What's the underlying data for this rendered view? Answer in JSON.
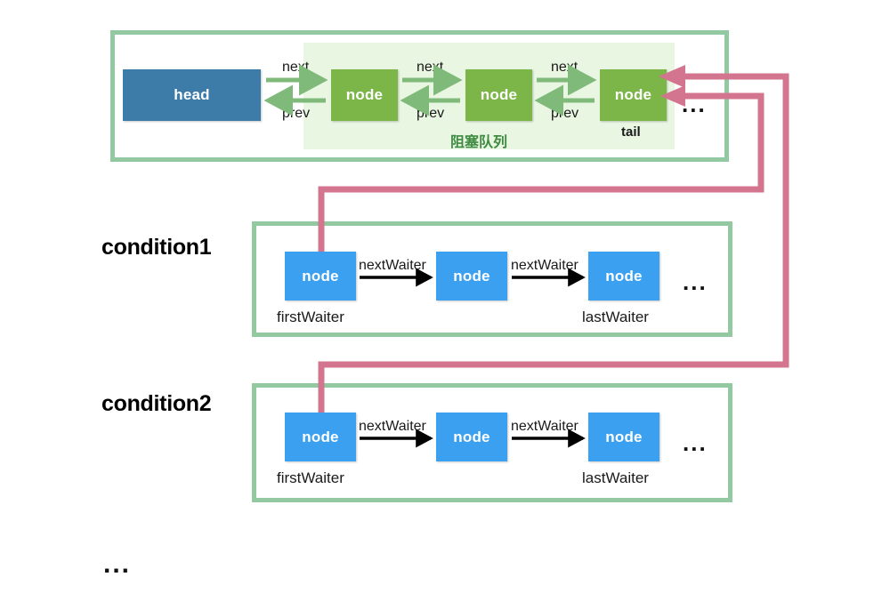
{
  "diagram": {
    "title_colors": {
      "panel_border": "#93c9a0",
      "queue_shade": "#e8f6e2",
      "head_box": "#3d7ba8",
      "queue_node": "#7cb648",
      "waiter_node": "#3ba0ef",
      "green_arrow": "#7fba7a",
      "pink_link": "#d4758f",
      "black_arrow": "#000000",
      "queue_label": "#3d8b40"
    },
    "queue_panel": {
      "shade_label": "阻塞队列",
      "head": {
        "label": "head"
      },
      "nodes": [
        {
          "label": "node",
          "caption": ""
        },
        {
          "label": "node",
          "caption": ""
        },
        {
          "label": "node",
          "caption": "tail"
        }
      ],
      "link_labels": [
        {
          "forward": "next",
          "backward": "prev"
        },
        {
          "forward": "next",
          "backward": "prev"
        },
        {
          "forward": "next",
          "backward": "prev"
        }
      ],
      "trailing_ellipsis": "..."
    },
    "conditions": [
      {
        "name": "condition1",
        "nodes": [
          {
            "label": "node",
            "caption": "firstWaiter"
          },
          {
            "label": "node",
            "caption": ""
          },
          {
            "label": "node",
            "caption": "lastWaiter"
          }
        ],
        "link_labels": [
          "nextWaiter",
          "nextWaiter"
        ],
        "trailing_ellipsis": "..."
      },
      {
        "name": "condition2",
        "nodes": [
          {
            "label": "node",
            "caption": "firstWaiter"
          },
          {
            "label": "node",
            "caption": ""
          },
          {
            "label": "node",
            "caption": "lastWaiter"
          }
        ],
        "link_labels": [
          "nextWaiter",
          "nextWaiter"
        ],
        "trailing_ellipsis": "..."
      }
    ],
    "more_conditions_ellipsis": "..."
  }
}
